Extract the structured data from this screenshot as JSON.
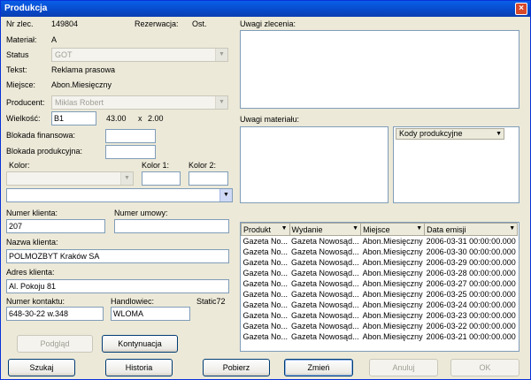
{
  "window": {
    "title": "Produkcja",
    "close_glyph": "×"
  },
  "order": {
    "nr_zlec_label": "Nr zlec.",
    "nr_zlec_value": "149804",
    "rezerwacja_label": "Rezerwacja:",
    "rezerwacja_value": "Ost.",
    "material_label": "Materiał:",
    "material_value": "A",
    "status_label": "Status",
    "status_value": "GOT",
    "tekst_label": "Tekst:",
    "tekst_value": "Reklama prasowa",
    "miejsce_label": "Miejsce:",
    "miejsce_value": "Abon.Miesięczny",
    "producent_label": "Producent:",
    "producent_value": "Miklas Robert",
    "wielkosc_label": "Wielkość:",
    "wielkosc_value": "B1",
    "wielkosc_w": "43.00",
    "wielkosc_x": "x",
    "wielkosc_h": "2.00",
    "blokada_fin_label": "Blokada finansowa:",
    "blokada_fin_value": "",
    "blokada_prod_label": "Blokada produkcyjna:",
    "blokada_prod_value": "",
    "kolor_label": "Kolor:",
    "kolor1_label": "Kolor 1:",
    "kolor2_label": "Kolor 2:",
    "kolor_value": "",
    "kolor1_value": "",
    "kolor2_value": "",
    "extra_combo_value": ""
  },
  "client": {
    "numer_klienta_label": "Numer klienta:",
    "numer_klienta_value": "207",
    "numer_umowy_label": "Numer umowy:",
    "numer_umowy_value": "",
    "nazwa_label": "Nazwa klienta:",
    "nazwa_value": "POLMOZBYT Kraków SA",
    "adres_label": "Adres klienta:",
    "adres_value": "Al. Pokoju 81",
    "kontakt_label": "Numer kontaktu:",
    "kontakt_value": "648-30-22 w.348",
    "handlowiec_label": "Handlowiec:",
    "handlowiec_value": "WLOMA",
    "static_label": "Static72"
  },
  "notes": {
    "uwagi_zlecenia_label": "Uwagi zlecenia:",
    "uwagi_materialu_label": "Uwagi materiału:",
    "kody_label": "Kody produkcyjne"
  },
  "grid": {
    "columns": [
      "Produkt",
      "Wydanie",
      "Miejsce",
      "Data emisji"
    ],
    "rows": [
      [
        "Gazeta No...",
        "Gazeta Nowosąd...",
        "Abon.Miesięczny",
        "2006-03-31 00:00:00.000"
      ],
      [
        "Gazeta No...",
        "Gazeta Nowosąd...",
        "Abon.Miesięczny",
        "2006-03-30 00:00:00.000"
      ],
      [
        "Gazeta No...",
        "Gazeta Nowosąd...",
        "Abon.Miesięczny",
        "2006-03-29 00:00:00.000"
      ],
      [
        "Gazeta No...",
        "Gazeta Nowosąd...",
        "Abon.Miesięczny",
        "2006-03-28 00:00:00.000"
      ],
      [
        "Gazeta No...",
        "Gazeta Nowosąd...",
        "Abon.Miesięczny",
        "2006-03-27 00:00:00.000"
      ],
      [
        "Gazeta No...",
        "Gazeta Nowosąd...",
        "Abon.Miesięczny",
        "2006-03-25 00:00:00.000"
      ],
      [
        "Gazeta No...",
        "Gazeta Nowosąd...",
        "Abon.Miesięczny",
        "2006-03-24 00:00:00.000"
      ],
      [
        "Gazeta No...",
        "Gazeta Nowosąd...",
        "Abon.Miesięczny",
        "2006-03-23 00:00:00.000"
      ],
      [
        "Gazeta No...",
        "Gazeta Nowosąd...",
        "Abon.Miesięczny",
        "2006-03-22 00:00:00.000"
      ],
      [
        "Gazeta No...",
        "Gazeta Nowosąd...",
        "Abon.Miesięczny",
        "2006-03-21 00:00:00.000"
      ]
    ]
  },
  "buttons": {
    "podglad": "Podgląd",
    "kontynuacja": "Kontynuacja",
    "szukaj": "Szukaj",
    "historia": "Historia",
    "pobierz": "Pobierz",
    "zmien": "Zmień",
    "anuluj": "Anuluj",
    "ok": "OK"
  },
  "icons": {
    "dropdown": "dropdown-arrow-icon",
    "close": "close-icon"
  }
}
